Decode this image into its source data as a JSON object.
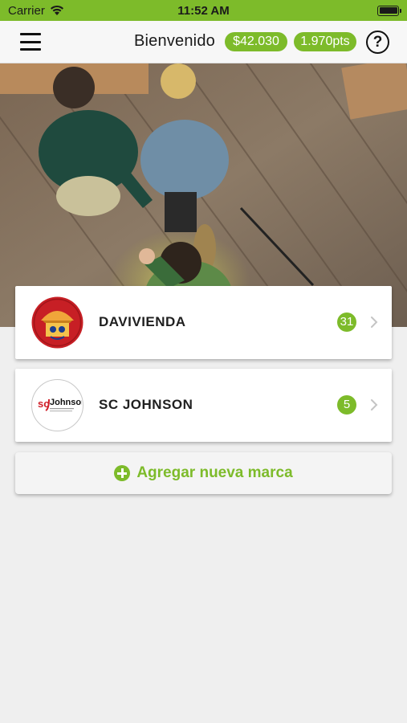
{
  "status_bar": {
    "carrier": "Carrier",
    "time": "11:52 AM",
    "wifi_icon": "wifi-icon",
    "battery_icon": "battery-icon"
  },
  "header": {
    "menu_icon": "hamburger-menu-icon",
    "welcome": "Bienvenido",
    "balance": "$42.030",
    "points": "1.970pts",
    "help_symbol": "?"
  },
  "hero": {
    "image": "photo-people-handshake-from-above"
  },
  "brands": [
    {
      "name": "DAVIVIENDA",
      "count": "31",
      "logo": "davivienda-logo"
    },
    {
      "name": "SC JOHNSON",
      "count": "5",
      "logo": "sc-johnson-logo",
      "logo_text_sc": "sc",
      "logo_text_johnson": "Johnson"
    }
  ],
  "add_brand": {
    "label": "Agregar nueva marca",
    "icon": "plus-circle-icon"
  },
  "colors": {
    "accent": "#7dbb2a",
    "background": "#efefef",
    "card": "#ffffff"
  }
}
